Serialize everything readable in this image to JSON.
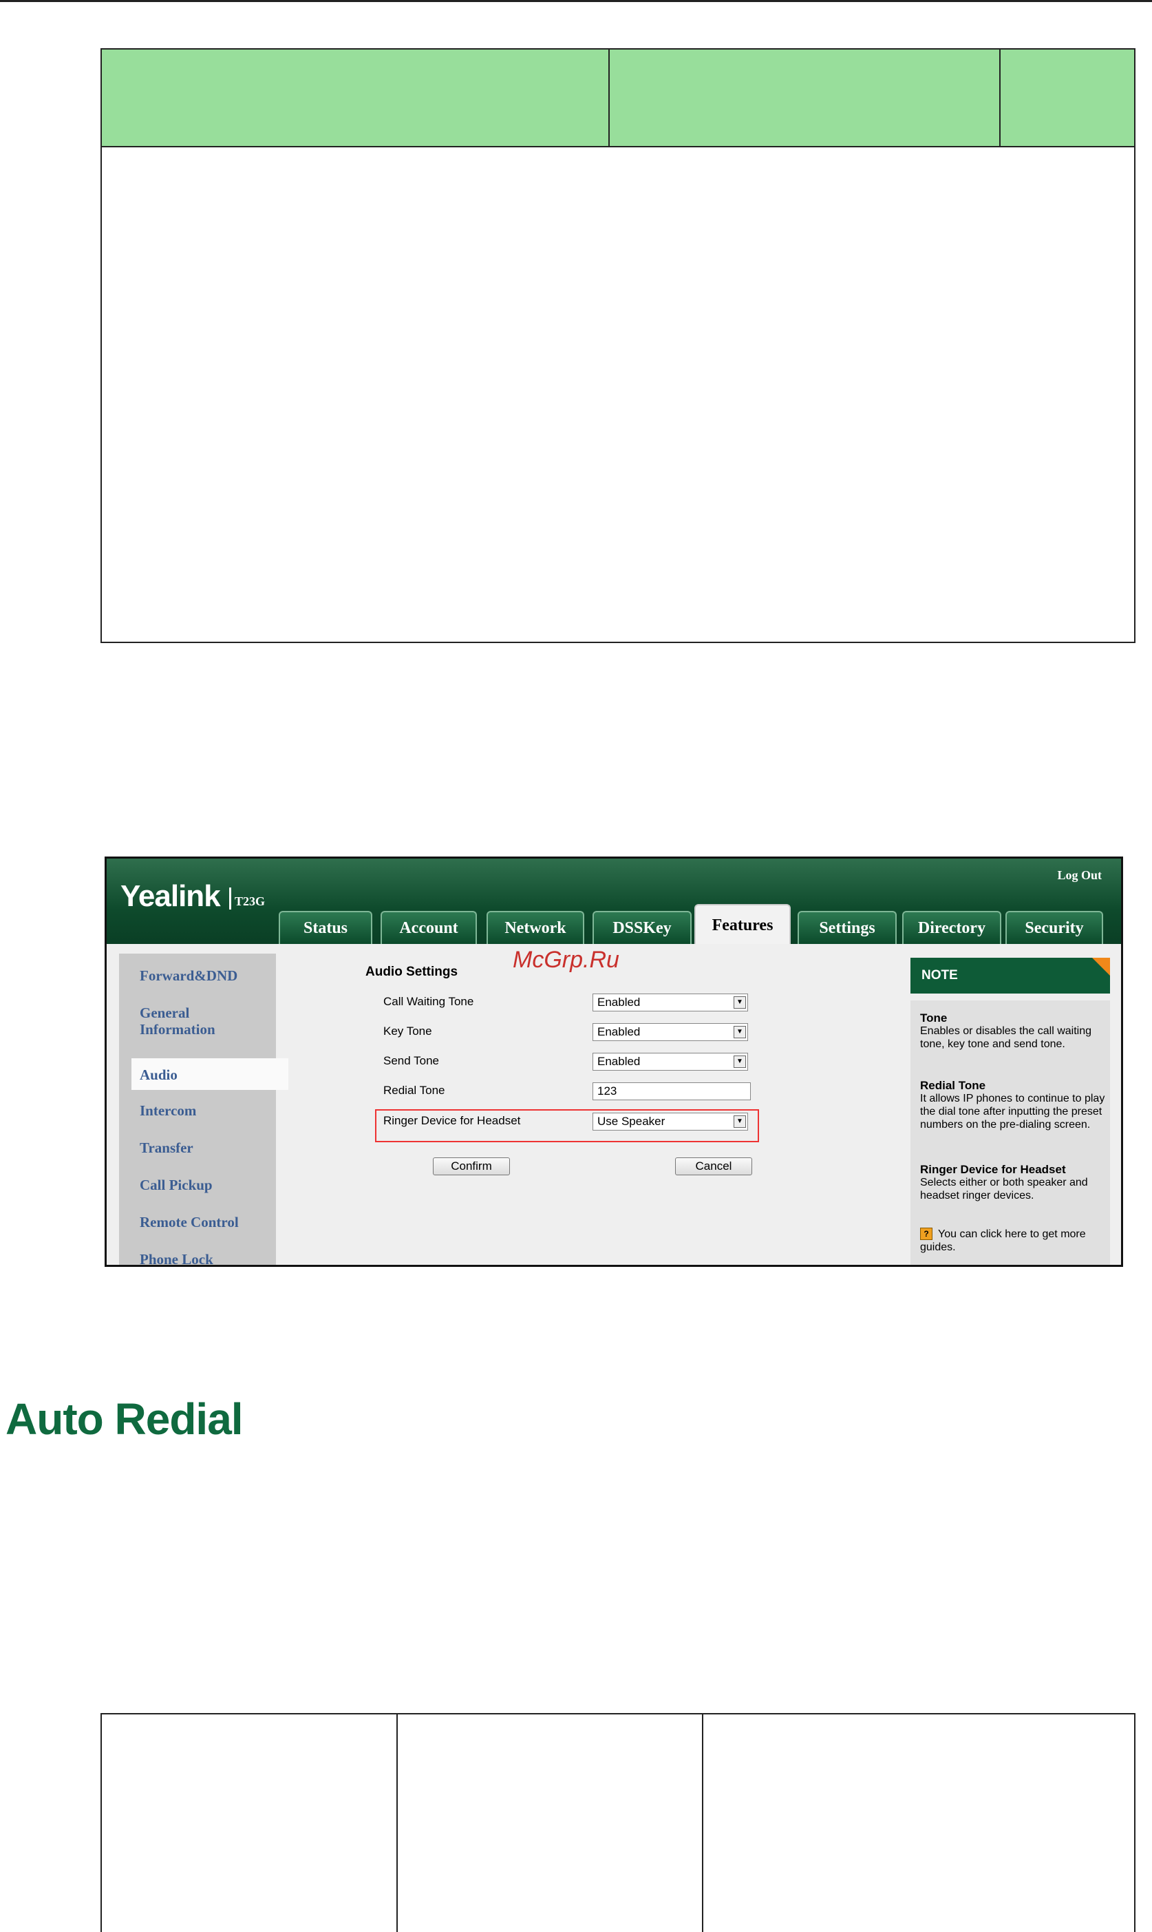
{
  "header": {
    "logo": "Yealink",
    "model": "T23G",
    "logout": "Log Out"
  },
  "tabs": [
    {
      "label": "Status"
    },
    {
      "label": "Account"
    },
    {
      "label": "Network"
    },
    {
      "label": "DSSKey"
    },
    {
      "label": "Features",
      "active": true
    },
    {
      "label": "Settings"
    },
    {
      "label": "Directory"
    },
    {
      "label": "Security"
    }
  ],
  "sidebar": {
    "items": [
      {
        "label": "Forward&DND"
      },
      {
        "label": "General\nInformation"
      },
      {
        "label": "Audio",
        "active": true
      },
      {
        "label": "Intercom"
      },
      {
        "label": "Transfer"
      },
      {
        "label": "Call Pickup"
      },
      {
        "label": "Remote Control"
      },
      {
        "label": "Phone Lock"
      }
    ]
  },
  "form": {
    "title": "Audio Settings",
    "rows": [
      {
        "label": "Call Waiting Tone",
        "value": "Enabled",
        "type": "select"
      },
      {
        "label": "Key Tone",
        "value": "Enabled",
        "type": "select"
      },
      {
        "label": "Send Tone",
        "value": "Enabled",
        "type": "select"
      },
      {
        "label": "Redial Tone",
        "value": "123",
        "type": "text"
      },
      {
        "label": "Ringer Device for Headset",
        "value": "Use Speaker",
        "type": "select"
      }
    ],
    "confirm_label": "Confirm",
    "cancel_label": "Cancel"
  },
  "watermark": "McGrp.Ru",
  "note": {
    "title": "NOTE",
    "tone_title": "Tone",
    "tone_desc": "Enables or disables the call waiting tone, key tone and send tone.",
    "redial_title": "Redial Tone",
    "redial_desc": "It allows IP phones to continue to play the dial tone after inputting the preset numbers on the pre-dialing screen.",
    "ringer_title": "Ringer Device for Headset",
    "ringer_desc": "Selects either or both speaker and headset ringer devices.",
    "guide": "You can click here to get more guides."
  },
  "section": {
    "heading": "Auto Redial"
  },
  "colors": {
    "table_header": "#98de9b",
    "brand_green": "#0e4a2c",
    "heading_green": "#0f6a3f",
    "highlight_red": "#e33333",
    "link_blue": "#3b5d92"
  }
}
